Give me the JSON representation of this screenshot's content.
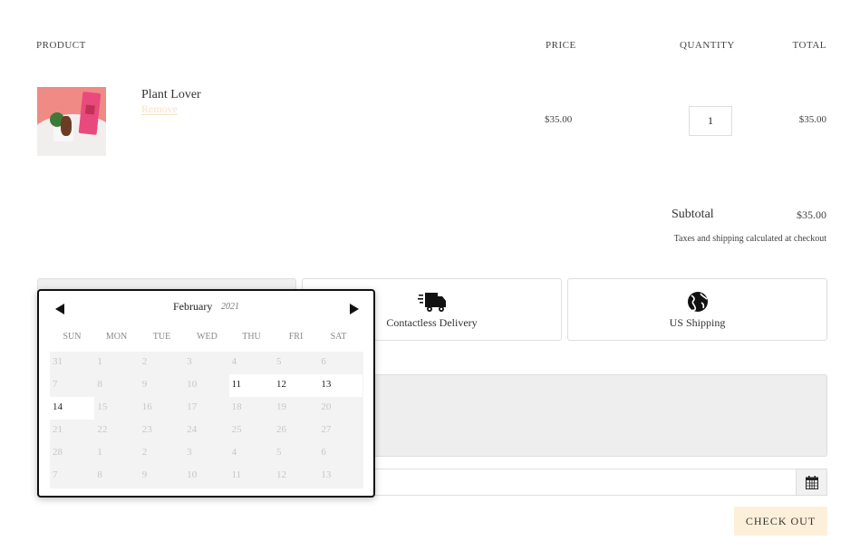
{
  "cart": {
    "headers": {
      "product": "PRODUCT",
      "price": "PRICE",
      "quantity": "QUANTITY",
      "total": "TOTAL"
    },
    "item": {
      "name": "Plant Lover",
      "remove_label": "Remove",
      "price": "$35.00",
      "quantity": "1",
      "total": "$35.00"
    }
  },
  "summary": {
    "subtotal_label": "Subtotal",
    "subtotal_value": "$35.00",
    "tax_note": "Taxes and shipping calculated at checkout"
  },
  "features": [
    {
      "label": "",
      "icon": "pickup-icon"
    },
    {
      "label": "Contactless Delivery",
      "icon": "delivery-truck-icon"
    },
    {
      "label": "US Shipping",
      "icon": "globe-icon"
    }
  ],
  "calendar": {
    "month": "February",
    "year": "2021",
    "weekdays": [
      "SUN",
      "MON",
      "TUE",
      "WED",
      "THU",
      "FRI",
      "SAT"
    ],
    "weeks": [
      [
        "31",
        "1",
        "2",
        "3",
        "4",
        "5",
        "6"
      ],
      [
        "7",
        "8",
        "9",
        "10",
        "11",
        "12",
        "13"
      ],
      [
        "14",
        "15",
        "16",
        "17",
        "18",
        "19",
        "20"
      ],
      [
        "21",
        "22",
        "23",
        "24",
        "25",
        "26",
        "27"
      ],
      [
        "28",
        "1",
        "2",
        "3",
        "4",
        "5",
        "6"
      ],
      [
        "7",
        "8",
        "9",
        "10",
        "11",
        "12",
        "13"
      ]
    ],
    "enabled": [
      [
        1,
        4
      ],
      [
        1,
        5
      ],
      [
        1,
        6
      ],
      [
        2,
        0
      ]
    ]
  },
  "checkout_label": "CHECK OUT",
  "colors": {
    "remove_link": "#f6e3c8",
    "checkout_bg": "#fdf0da",
    "calendar_border": "#111111"
  }
}
